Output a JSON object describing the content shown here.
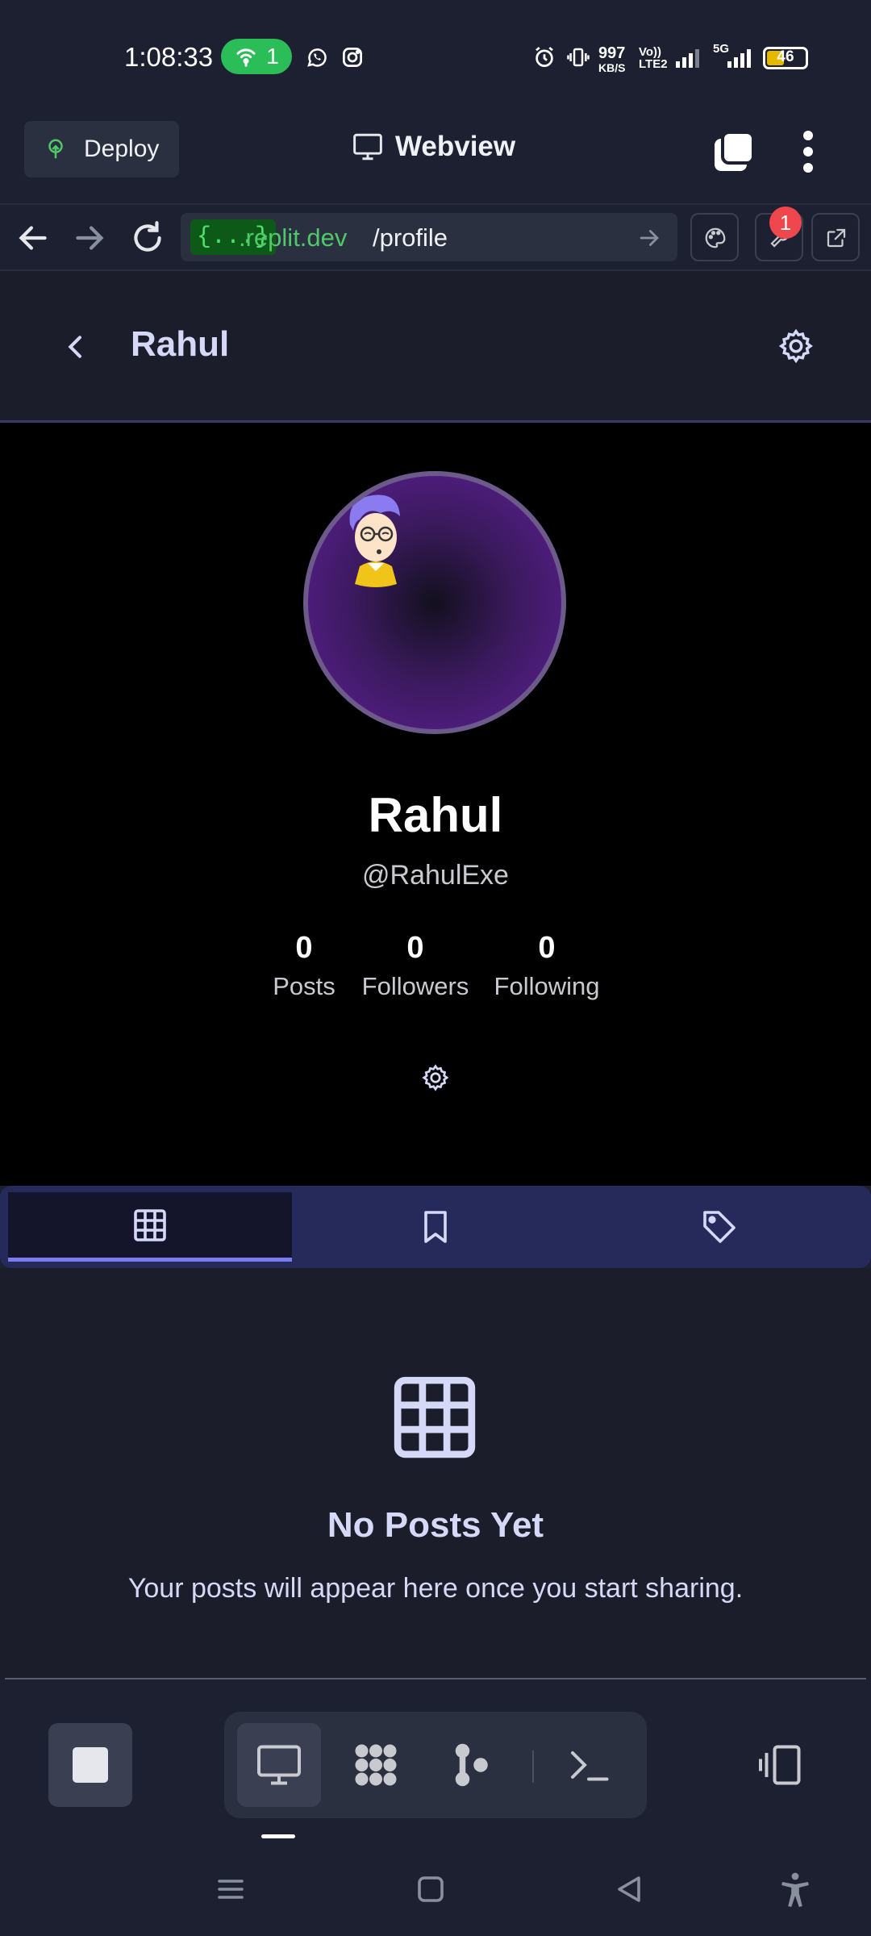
{
  "status_bar": {
    "time": "1:08:33",
    "hotspot_count": "1",
    "net_speed_value": "997",
    "net_speed_unit": "KB/S",
    "volte_line1": "Vo))",
    "volte_line2": "LTE2",
    "network_type": "5G",
    "battery": "46"
  },
  "replit": {
    "deploy_label": "Deploy",
    "webview_title": "Webview",
    "url_badge": "{...}",
    "url_domain": ".replit.dev",
    "url_path": "/profile",
    "tools_badge": "1"
  },
  "app_header": {
    "title": "Rahul"
  },
  "profile": {
    "name": "Rahul",
    "handle": "@RahulExe",
    "stats": [
      {
        "value": "0",
        "label": "Posts"
      },
      {
        "value": "0",
        "label": "Followers"
      },
      {
        "value": "0",
        "label": "Following"
      }
    ]
  },
  "content_tabs": [
    {
      "icon": "grid-icon",
      "active": true
    },
    {
      "icon": "bookmark-icon",
      "active": false
    },
    {
      "icon": "tag-icon",
      "active": false
    }
  ],
  "empty_state": {
    "title": "No Posts Yet",
    "subtitle": "Your posts will appear here once you start sharing."
  },
  "colors": {
    "accent": "#7a7cf0",
    "page_bg": "#1c1d2b",
    "tab_bar": "#262a5a",
    "hotspot_green": "#2bbd58",
    "url_green": "#4fc868",
    "badge_red": "#f0474f"
  }
}
